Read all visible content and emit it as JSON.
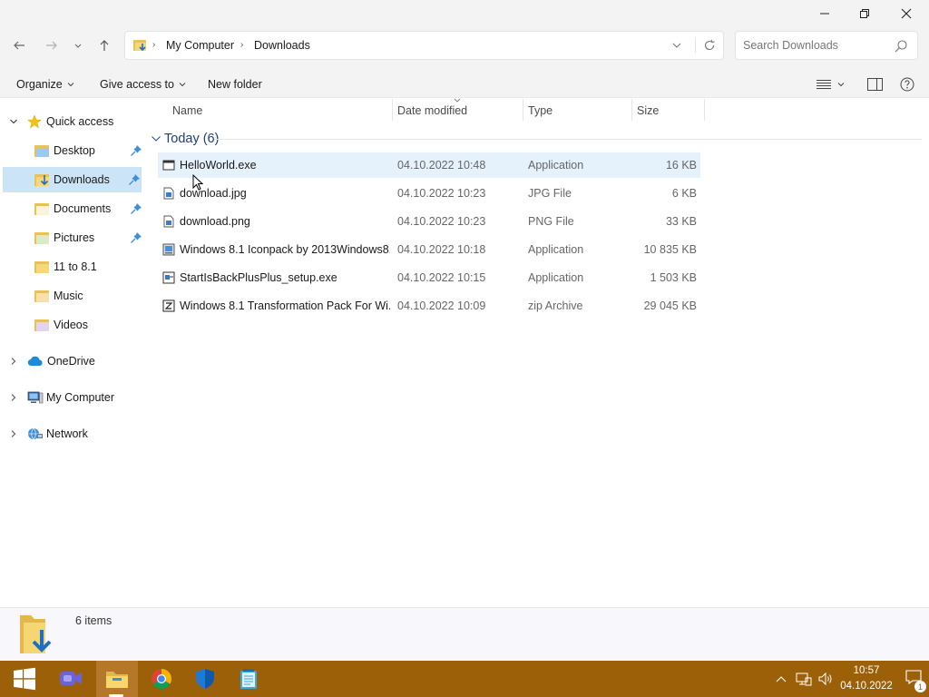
{
  "window": {
    "minimize_icon": "minimize-icon",
    "maximize_icon": "restore-icon",
    "close_icon": "close-icon"
  },
  "address": {
    "crumbs": [
      "My Computer",
      "Downloads"
    ],
    "search_placeholder": "Search Downloads"
  },
  "toolbar": {
    "organize": "Organize",
    "give_access": "Give access to",
    "new_folder": "New folder"
  },
  "nav": {
    "quick_access": "Quick access",
    "items": [
      {
        "label": "Desktop",
        "pinned": true
      },
      {
        "label": "Downloads",
        "pinned": true,
        "selected": true
      },
      {
        "label": "Documents",
        "pinned": true
      },
      {
        "label": "Pictures",
        "pinned": true
      },
      {
        "label": "11 to 8.1",
        "pinned": false
      },
      {
        "label": "Music",
        "pinned": false
      },
      {
        "label": "Videos",
        "pinned": false
      }
    ],
    "onedrive": "OneDrive",
    "my_computer": "My Computer",
    "network": "Network"
  },
  "columns": {
    "name": "Name",
    "date": "Date modified",
    "type": "Type",
    "size": "Size"
  },
  "group": {
    "label": "Today (6)"
  },
  "files": [
    {
      "name": "HelloWorld.exe",
      "date": "04.10.2022 10:48",
      "type": "Application",
      "size": "16 KB"
    },
    {
      "name": "download.jpg",
      "date": "04.10.2022 10:23",
      "type": "JPG File",
      "size": "6 KB"
    },
    {
      "name": "download.png",
      "date": "04.10.2022 10:23",
      "type": "PNG File",
      "size": "33 KB"
    },
    {
      "name": "Windows 8.1 Iconpack by 2013Windows8...",
      "date": "04.10.2022 10:18",
      "type": "Application",
      "size": "10 835 KB"
    },
    {
      "name": "StartIsBackPlusPlus_setup.exe",
      "date": "04.10.2022 10:15",
      "type": "Application",
      "size": "1 503 KB"
    },
    {
      "name": "Windows 8.1 Transformation Pack For Wi...",
      "date": "04.10.2022 10:09",
      "type": "zip Archive",
      "size": "29 045 KB"
    }
  ],
  "status": {
    "count": "6 items"
  },
  "taskbar": {
    "time": "10:57",
    "date": "04.10.2022",
    "notification_count": "1",
    "accent": "#9c6008"
  }
}
